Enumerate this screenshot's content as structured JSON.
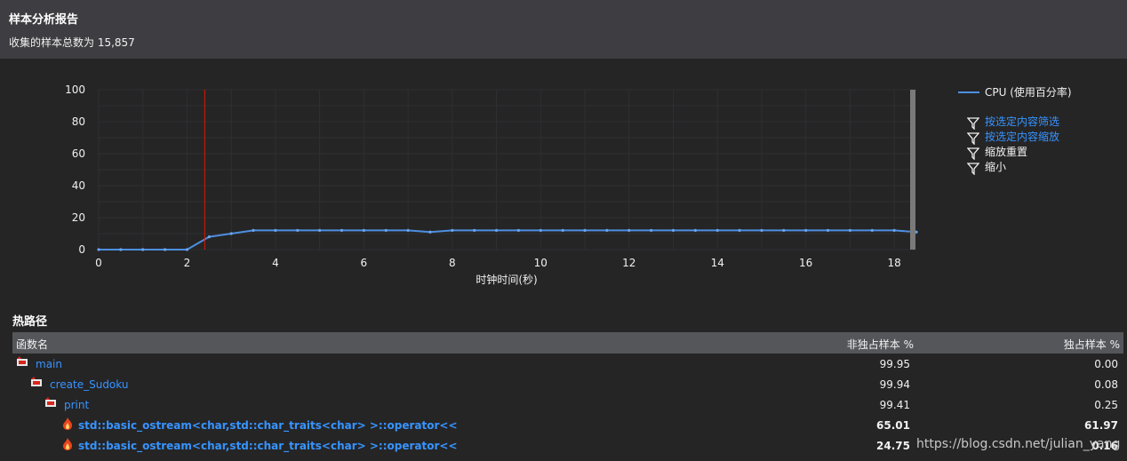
{
  "header": {
    "title": "样本分析报告",
    "summary": "收集的样本总数为 15,857"
  },
  "chart_data": {
    "type": "line",
    "x": [
      0,
      0.5,
      1,
      1.5,
      2,
      2.5,
      3,
      3.5,
      4,
      4.5,
      5,
      5.5,
      6,
      6.5,
      7,
      7.5,
      8,
      8.5,
      9,
      9.5,
      10,
      10.5,
      11,
      11.5,
      12,
      12.5,
      13,
      13.5,
      14,
      14.5,
      15,
      15.5,
      16,
      16.5,
      17,
      17.5,
      18,
      18.5
    ],
    "series": [
      {
        "name": "CPU (使用百分率)",
        "color": "#4d8fe0",
        "values": [
          0,
          0,
          0,
          0,
          0,
          8,
          10,
          12,
          12,
          12,
          12,
          12,
          12,
          12,
          12,
          11,
          12,
          12,
          12,
          12,
          12,
          12,
          12,
          12,
          12,
          12,
          12,
          12,
          12,
          12,
          12,
          12,
          12,
          12,
          12,
          12,
          12,
          11
        ]
      }
    ],
    "xticks": [
      "0",
      "2",
      "4",
      "6",
      "8",
      "10",
      "12",
      "14",
      "16",
      "18"
    ],
    "yticks": [
      "0",
      "20",
      "40",
      "60",
      "80",
      "100"
    ],
    "xlim": [
      0,
      18.5
    ],
    "ylim": [
      0,
      100
    ],
    "xlabel": "时钟时间(秒)",
    "ylabel": "",
    "grid": true,
    "marker_x": 2.4,
    "marker_color": "#e51400",
    "legend_position": "right"
  },
  "legend": {
    "label": "CPU (使用百分率)",
    "color": "#4d8fe0"
  },
  "menu": [
    {
      "label": "按选定内容筛选",
      "style": "link"
    },
    {
      "label": "按选定内容缩放",
      "style": "link"
    },
    {
      "label": "缩放重置",
      "style": "plain"
    },
    {
      "label": "缩小",
      "style": "plain"
    }
  ],
  "hotpath": {
    "title": "热路径",
    "columns": [
      "函数名",
      "非独占样本 %",
      "独占样本 %"
    ],
    "rows": [
      {
        "name": "main",
        "inclusive": "99.95",
        "exclusive": "0.00",
        "level": 0,
        "icon": "hot-path-icon",
        "hot": false
      },
      {
        "name": "create_Sudoku",
        "inclusive": "99.94",
        "exclusive": "0.08",
        "level": 1,
        "icon": "hot-path-icon",
        "hot": false
      },
      {
        "name": "print",
        "inclusive": "99.41",
        "exclusive": "0.25",
        "level": 2,
        "icon": "hot-path-icon",
        "hot": false
      },
      {
        "name": "std::basic_ostream<char,std::char_traits<char> >::operator<<",
        "inclusive": "65.01",
        "exclusive": "61.97",
        "level": 3,
        "icon": "flame-icon",
        "hot": true
      },
      {
        "name": "std::basic_ostream<char,std::char_traits<char> >::operator<<",
        "inclusive": "24.75",
        "exclusive": "0.16",
        "level": 3,
        "icon": "flame-icon",
        "hot": true
      }
    ]
  },
  "watermark": "https://blog.csdn.net/julian_yang"
}
